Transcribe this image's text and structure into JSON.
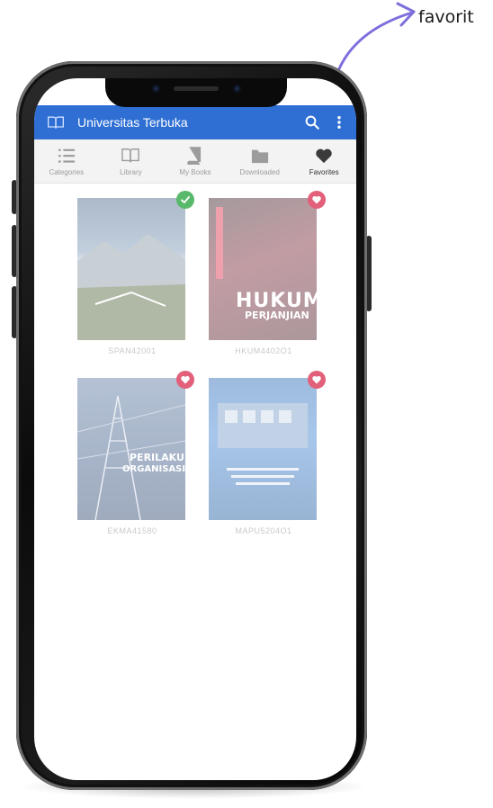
{
  "annotation": {
    "label": "favorit"
  },
  "app_bar": {
    "title": "Universitas Terbuka",
    "icon": "book-open-icon",
    "actions": [
      "search-icon",
      "more-vertical-icon"
    ]
  },
  "tabs": [
    {
      "label": "Categories",
      "icon": "list-icon",
      "active": false
    },
    {
      "label": "Library",
      "icon": "book-open-icon",
      "active": false
    },
    {
      "label": "My Books",
      "icon": "book-icon",
      "active": false
    },
    {
      "label": "Downloaded",
      "icon": "folder-icon",
      "active": false
    },
    {
      "label": "Favorites",
      "icon": "heart-icon",
      "active": true
    }
  ],
  "books": [
    {
      "code": "SPAN42001",
      "badge": "check-icon",
      "cover_text": ""
    },
    {
      "code": "HKUM4402O1",
      "badge": "heart-icon",
      "cover_text": "HUKUM",
      "cover_subtext": "PERJANJIAN"
    },
    {
      "code": "EKMA41580",
      "badge": "heart-icon",
      "cover_text": "PERILAKU",
      "cover_subtext": "ORGANISASI"
    },
    {
      "code": "MAPU5204O1",
      "badge": "heart-icon",
      "cover_text": ""
    }
  ],
  "colors": {
    "app_bar": "#2f6fd4",
    "badge_check": "#59b96a",
    "badge_heart": "#e2607a"
  }
}
